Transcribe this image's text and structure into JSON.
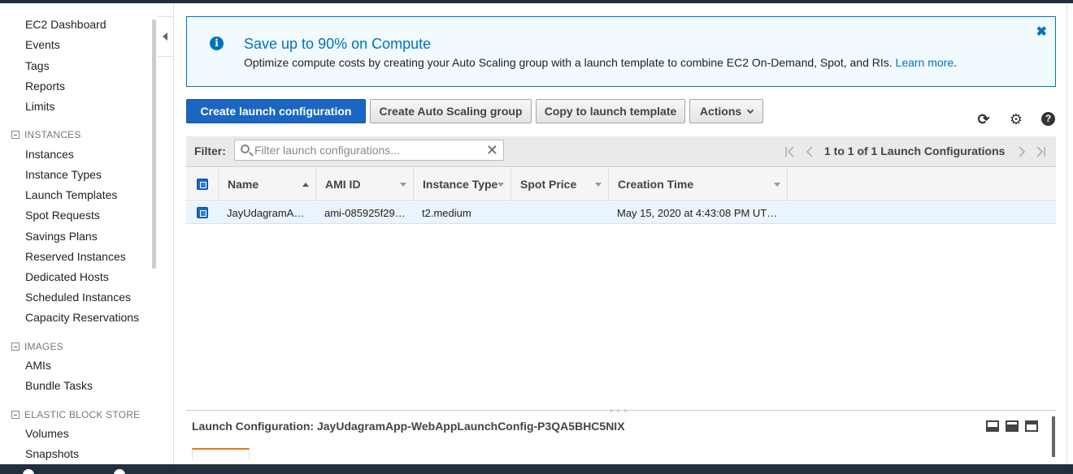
{
  "sidebar": {
    "top_items": [
      "EC2 Dashboard",
      "Events",
      "Tags",
      "Reports",
      "Limits"
    ],
    "sections": [
      {
        "title": "INSTANCES",
        "items": [
          "Instances",
          "Instance Types",
          "Launch Templates",
          "Spot Requests",
          "Savings Plans",
          "Reserved Instances",
          "Dedicated Hosts",
          "Scheduled Instances",
          "Capacity Reservations"
        ]
      },
      {
        "title": "IMAGES",
        "items": [
          "AMIs",
          "Bundle Tasks"
        ]
      },
      {
        "title": "ELASTIC BLOCK STORE",
        "items": [
          "Volumes",
          "Snapshots"
        ]
      }
    ]
  },
  "banner": {
    "title": "Save up to 90% on Compute",
    "description": "Optimize compute costs by creating your Auto Scaling group with a launch template to combine EC2 On-Demand, Spot, and RIs.",
    "link": "Learn more",
    "trailing": ".",
    "close": "✖"
  },
  "toolbar": {
    "create_launch_config": "Create launch configuration",
    "create_asg": "Create Auto Scaling group",
    "copy_to_template": "Copy to launch template",
    "actions": "Actions"
  },
  "filter": {
    "label": "Filter:",
    "placeholder": "Filter launch configurations...",
    "clear": "✕",
    "pagination": "1 to 1 of 1 Launch Configurations"
  },
  "table": {
    "columns": [
      "Name",
      "AMI ID",
      "Instance Type",
      "Spot Price",
      "Creation Time"
    ],
    "rows": [
      {
        "name": "JayUdagramA…",
        "ami_id": "ami-085925f29…",
        "instance_type": "t2.medium",
        "spot_price": "",
        "creation_time": "May 15, 2020 at 4:43:08 PM UT…"
      }
    ]
  },
  "detail": {
    "title": "Launch Configuration: JayUdagramApp-WebAppLaunchConfig-P3QA5BHC5NIX",
    "grip": "° ° °"
  },
  "icons": {
    "refresh": "⟳",
    "settings": "⚙",
    "help": "?"
  }
}
